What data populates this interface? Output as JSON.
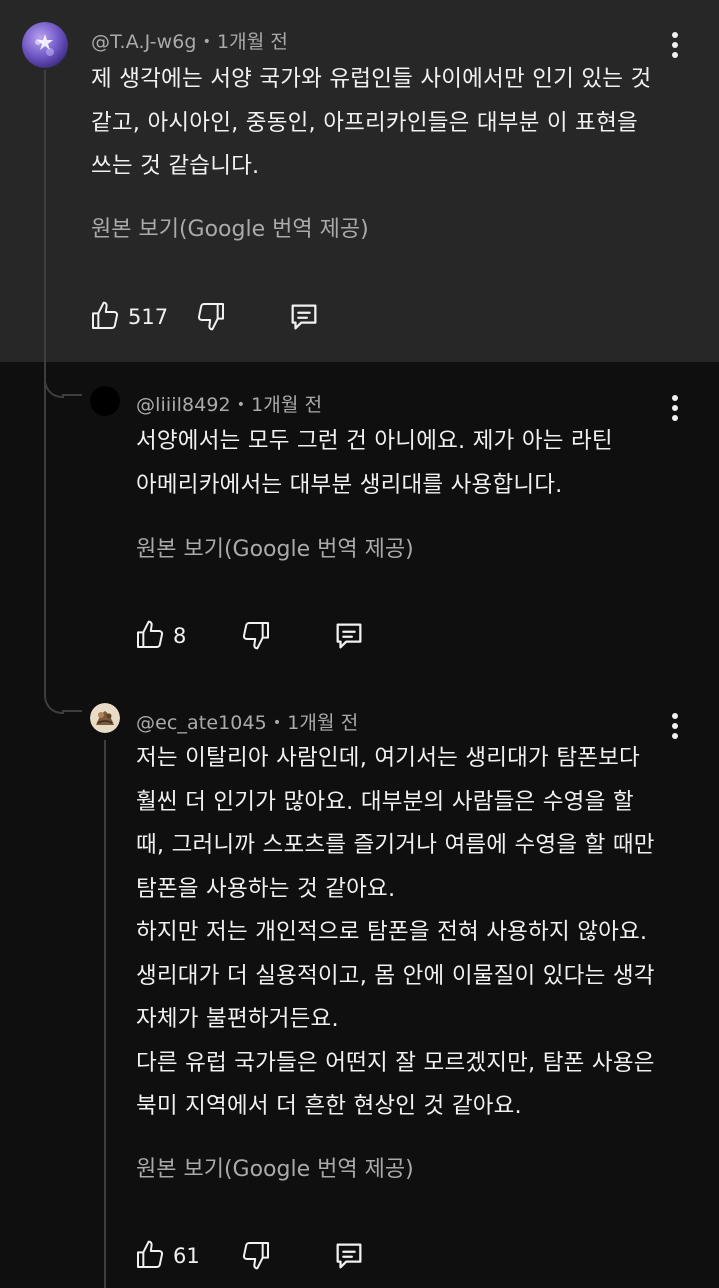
{
  "comments": [
    {
      "author": "@T.A.J-w6g",
      "time": "1개월 전",
      "body": "제 생각에는 서양 국가와 유럽인들 사이에서만 인기 있는 것\n같고, 아시아인, 중동인, 아프리카인들은 대부분 이 표현을\n쓰는 것 같습니다.",
      "translate": "원본 보기(Google 번역 제공)",
      "likes": "517"
    },
    {
      "author": "@liiil8492",
      "time": "1개월 전",
      "body": "서양에서는 모두 그런 건 아니에요. 제가 아는 라틴\n아메리카에서는 대부분 생리대를 사용합니다.",
      "translate": "원본 보기(Google 번역 제공)",
      "likes": "8"
    },
    {
      "author": "@ec_ate1045",
      "time": "1개월 전",
      "body": "저는 이탈리아 사람인데, 여기서는 생리대가 탐폰보다\n훨씬 더 인기가 많아요. 대부분의 사람들은 수영을 할\n때, 그러니까 스포츠를 즐기거나 여름에 수영을 할 때만\n탐폰을 사용하는 것 같아요.\n하지만 저는 개인적으로 탐폰을 전혀 사용하지 않아요.\n생리대가 더 실용적이고, 몸 안에 이물질이 있다는 생각\n자체가 불편하거든요.\n다른 유럽 국가들은 어떤지 잘 모르겠지만, 탐폰 사용은\n북미 지역에서 더 흔한 현상인 것 같아요.",
      "translate": "원본 보기(Google 번역 제공)",
      "likes": "61"
    }
  ],
  "icons": {
    "like": "thumbs-up-icon",
    "dislike": "thumbs-down-icon",
    "reply": "reply-comment-icon",
    "more": "more-vert-icon"
  },
  "colors": {
    "background": "#0f0f0f",
    "highlight": "#272727",
    "text": "#f1f1f1",
    "secondary": "#aaaaaa"
  }
}
